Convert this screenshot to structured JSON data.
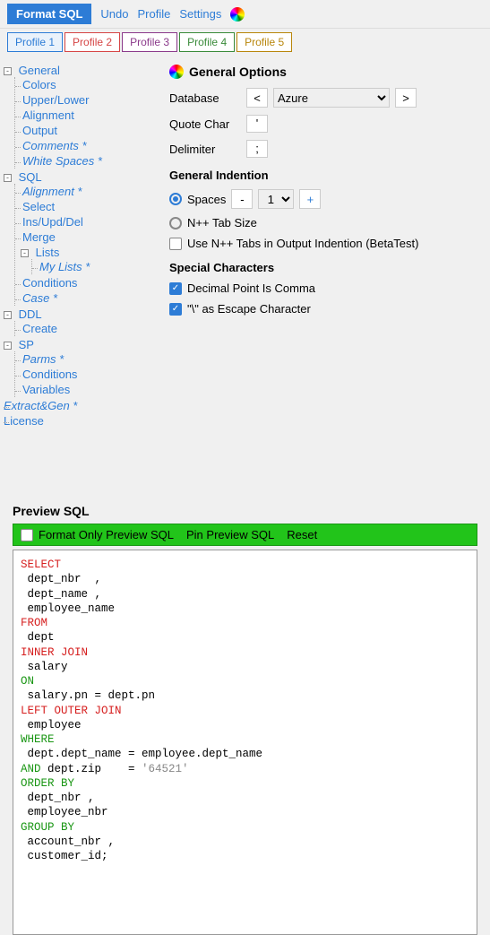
{
  "toolbar": {
    "format_sql": "Format SQL",
    "undo": "Undo",
    "profile": "Profile",
    "settings": "Settings"
  },
  "profiles": [
    "Profile 1",
    "Profile 2",
    "Profile 3",
    "Profile 4",
    "Profile 5"
  ],
  "tree": {
    "general": {
      "label": "General",
      "colors": "Colors",
      "upper_lower": "Upper/Lower",
      "alignment": "Alignment",
      "output": "Output",
      "comments": "Comments *",
      "white_spaces": "White Spaces *"
    },
    "sql": {
      "label": "SQL",
      "alignment": "Alignment *",
      "select": "Select",
      "ins_upd_del": "Ins/Upd/Del",
      "merge": "Merge",
      "lists": "Lists",
      "my_lists": "My Lists *",
      "conditions": "Conditions",
      "case": "Case *"
    },
    "ddl": {
      "label": "DDL",
      "create": "Create"
    },
    "sp": {
      "label": "SP",
      "parms": "Parms *",
      "conditions": "Conditions",
      "variables": "Variables"
    },
    "extract_gen": "Extract&Gen *",
    "license": "License"
  },
  "general_options": {
    "title": "General Options",
    "database_label": "Database",
    "database_value": "Azure",
    "prev_btn": "<",
    "next_btn": ">",
    "quote_char_label": "Quote Char",
    "quote_char_value": "'",
    "delimiter_label": "Delimiter",
    "delimiter_value": ";",
    "indention_title": "General Indention",
    "spaces_label": "Spaces",
    "spaces_value": "1",
    "minus": "-",
    "plus": "+",
    "npp_tab_label": "N++ Tab Size",
    "use_npp_tabs": "Use N++ Tabs in Output Indention (BetaTest)",
    "special_chars_title": "Special Characters",
    "decimal_comma": "Decimal Point Is Comma",
    "escape_char": "\"\\\" as Escape Character"
  },
  "preview": {
    "title": "Preview SQL",
    "format_only": "Format Only Preview SQL",
    "pin_preview": "Pin Preview SQL",
    "reset": "Reset"
  },
  "sql_tokens": {
    "select": "SELECT",
    "line_dept_nbr": " dept_nbr  ,",
    "line_dept_name": " dept_name ,",
    "line_employee_name": " employee_name",
    "from": "FROM",
    "line_dept": " dept",
    "inner_join": "INNER JOIN",
    "line_salary": " salary",
    "on": "ON",
    "line_on_cond": " salary.pn = dept.pn",
    "left_outer_join": "LEFT OUTER JOIN",
    "line_employee": " employee",
    "where": "WHERE",
    "line_where_cond": " dept.dept_name = employee.dept_name",
    "and": "AND",
    "line_and_field": " dept.zip    = ",
    "line_and_value": "'64521'",
    "order_by": "ORDER BY",
    "line_ob_1": " dept_nbr ,",
    "line_ob_2": " employee_nbr",
    "group_by": "GROUP BY",
    "line_gb_1": " account_nbr ,",
    "line_gb_2": " customer_id;"
  }
}
